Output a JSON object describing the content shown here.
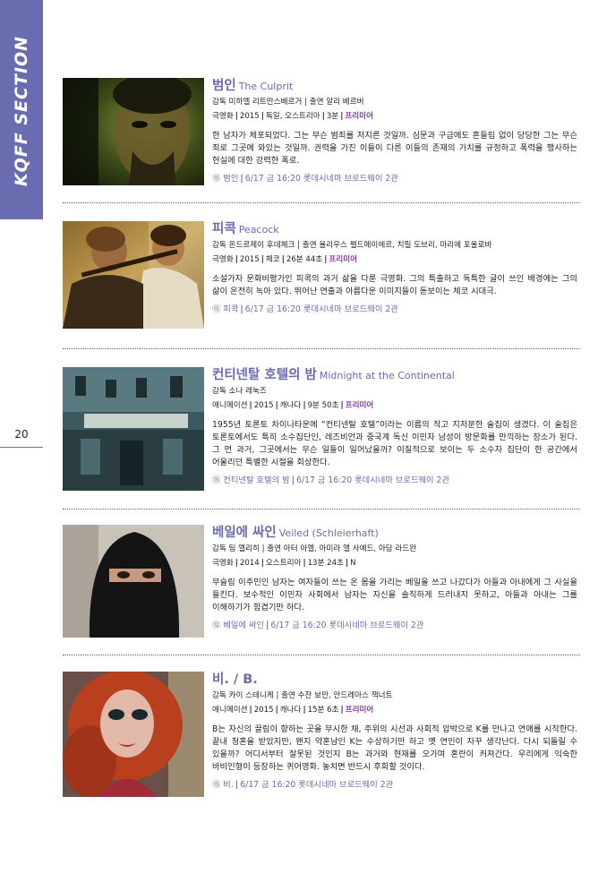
{
  "section_tab": "KQFF SECTION",
  "page_number": "20",
  "films": [
    {
      "title_ko": "범인",
      "title_en": "The Culprit",
      "credits": "감독 미하엘 리트만스베르거 | 출연 알리 베르버",
      "genre": "극영화",
      "year": "2015",
      "country": "독일, 오스트리아",
      "runtime": "3분",
      "premiere": "프리미어",
      "synopsis": "한 남자가 체포되었다. 그는 무슨 범죄를 저지른 것일까. 심문과 구금에도 흔들림 없이 당당한 그는 무슨 죄로 그곳에 와있는 것일까. 권력을 가진 이들이 다른 이들의 존재의 가치를 규정하고 폭력을 행사하는 현실에 대한 강력한 폭로.",
      "rating": "⑮",
      "screening_title": "범인",
      "screening": "6/17 금 16:20 롯데시네마 브로드웨이 2관"
    },
    {
      "title_ko": "피콕",
      "title_en": "Peacock",
      "credits": "감독 온드르제이 후데체크 | 출연 율리우스 펠드메이에르, 치릴 도브리, 마리에 포울로바",
      "genre": "극영화",
      "year": "2015",
      "country": "체코",
      "runtime": "26분 44초",
      "premiere": "프리미어",
      "synopsis": "소설가자 문화비평가인 피콕의 과거 삶을 다룬 극영화. 그의 특출하고 독특한 글이 쓰인 배경에는 그의 삶이 온전히 녹아 있다. 뛰어난 연출과 아름다운 이미지들이 돋보이는 체코 시대극.",
      "rating": "⑮",
      "screening_title": "피콕",
      "screening": "6/17 금 16:20 롯데시네마 브로드웨이 2관"
    },
    {
      "title_ko": "컨티넨탈 호텔의 밤",
      "title_en": "Midnight at the Continental",
      "credits": "감독 소나 레눅즈",
      "genre": "애니메이션",
      "year": "2015",
      "country": "캐나다",
      "runtime": "9분 50초",
      "premiere": "프리미어",
      "synopsis": "1955년 토론토 차이나타운에 “컨티넨탈 호텔”이라는 이름의 작고 지저분한 술집이 생겼다. 이 술집은 토론토에서도 특히 소수집단인, 레즈비언과 중국계 독신 이민자 남성이 방문화를 만끽하는 장소가 된다. 그 먼 과거, 그곳에서는 무슨 일들이 일어났을까? 이질적으로 보이는 두 소수자 집단이 한 공간에서 어울리던 특별한 시절을 회상한다.",
      "rating": "⑮",
      "screening_title": "컨티넨탈 호텔의 밤",
      "screening": "6/17 금 16:20 롯데시네마 브로드웨이 2관"
    },
    {
      "title_ko": "베일에 싸인",
      "title_en": "Veiled (Schleierhaft)",
      "credits": "감독 팀 엘리히 | 출연 아터 아엘, 아미라 엘 사예드, 아담 라드완",
      "genre": "극영화",
      "year": "2014",
      "country": "오스트리아",
      "runtime": "13분 24초",
      "premiere": "N",
      "synopsis": "무슬림 이주민인 남자는 여자들이 쓰는 온 몸을 가리는 베일을 쓰고 나갔다가 아들과 아내에게 그 사실을 들킨다. 보수적인 이민자 사회에서 남자는 자신을 솔직하게 드러내지 못하고, 아들과 아내는 그를 이해하기가 힘겹기만 하다.",
      "rating": "⑫",
      "screening_title": "베일에 싸인",
      "screening": "6/17 금 16:20 롯데시네마 브로드웨이 2관"
    },
    {
      "title_ko": "비. / B.",
      "title_en": "",
      "credits": "감독 카이 스테니케 | 출연 수잔 보만, 안드레아스 잭너트",
      "genre": "애니메이션",
      "year": "2015",
      "country": "캐나다",
      "runtime": "15분 6초",
      "premiere": "프리미어",
      "synopsis": "B는 자신의 끌림이 향하는 곳을 무시한 채, 주위의 시선과 사회적 압박으로 K를 만나고 연애를 시작한다. 끝내 청혼을 받았지만, 왠지 약혼남인 K는 수상하기만 하고 옛 연인이 자꾸 생각난다. 다시 되돌릴 수 있을까? 어디서부터 잘못된 것인지 B는 과거와 현재를 오가며 혼란이 커져간다. 우리에게 익숙한 바비인형이 등장하는 퀴어영화. 놓치면 반드시 후회할 것이다.",
      "rating": "⑮",
      "screening_title": "비.",
      "screening": "6/17 금 16:20 롯데시네마 브로드웨이 2관"
    }
  ]
}
